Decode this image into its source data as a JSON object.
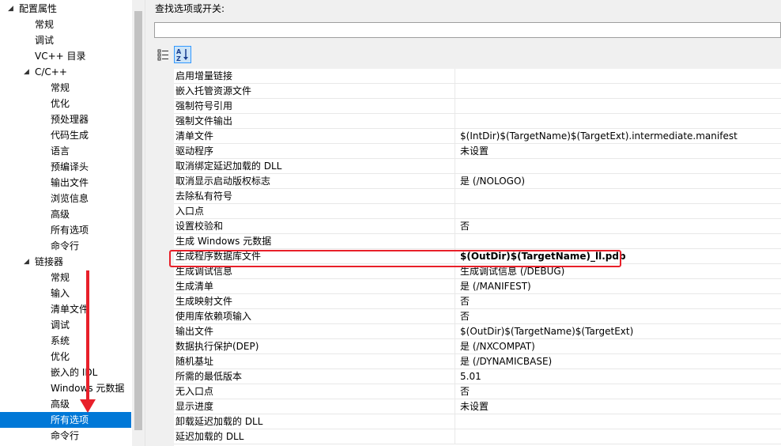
{
  "tree": {
    "items": [
      {
        "label": "配置属性",
        "indent": 1,
        "arrow": "◢",
        "selected": false
      },
      {
        "label": "常规",
        "indent": 2,
        "arrow": "",
        "selected": false
      },
      {
        "label": "调试",
        "indent": 2,
        "arrow": "",
        "selected": false
      },
      {
        "label": "VC++ 目录",
        "indent": 2,
        "arrow": "",
        "selected": false
      },
      {
        "label": "C/C++",
        "indent": 2,
        "arrow": "◢",
        "selected": false
      },
      {
        "label": "常规",
        "indent": 3,
        "arrow": "",
        "selected": false
      },
      {
        "label": "优化",
        "indent": 3,
        "arrow": "",
        "selected": false
      },
      {
        "label": "预处理器",
        "indent": 3,
        "arrow": "",
        "selected": false
      },
      {
        "label": "代码生成",
        "indent": 3,
        "arrow": "",
        "selected": false
      },
      {
        "label": "语言",
        "indent": 3,
        "arrow": "",
        "selected": false
      },
      {
        "label": "预编译头",
        "indent": 3,
        "arrow": "",
        "selected": false
      },
      {
        "label": "输出文件",
        "indent": 3,
        "arrow": "",
        "selected": false
      },
      {
        "label": "浏览信息",
        "indent": 3,
        "arrow": "",
        "selected": false
      },
      {
        "label": "高级",
        "indent": 3,
        "arrow": "",
        "selected": false
      },
      {
        "label": "所有选项",
        "indent": 3,
        "arrow": "",
        "selected": false
      },
      {
        "label": "命令行",
        "indent": 3,
        "arrow": "",
        "selected": false
      },
      {
        "label": "链接器",
        "indent": 2,
        "arrow": "◢",
        "selected": false
      },
      {
        "label": "常规",
        "indent": 3,
        "arrow": "",
        "selected": false
      },
      {
        "label": "输入",
        "indent": 3,
        "arrow": "",
        "selected": false
      },
      {
        "label": "清单文件",
        "indent": 3,
        "arrow": "",
        "selected": false
      },
      {
        "label": "调试",
        "indent": 3,
        "arrow": "",
        "selected": false
      },
      {
        "label": "系统",
        "indent": 3,
        "arrow": "",
        "selected": false
      },
      {
        "label": "优化",
        "indent": 3,
        "arrow": "",
        "selected": false
      },
      {
        "label": "嵌入的 IDL",
        "indent": 3,
        "arrow": "",
        "selected": false
      },
      {
        "label": "Windows 元数据",
        "indent": 3,
        "arrow": "",
        "selected": false
      },
      {
        "label": "高级",
        "indent": 3,
        "arrow": "",
        "selected": false
      },
      {
        "label": "所有选项",
        "indent": 3,
        "arrow": "",
        "selected": true
      },
      {
        "label": "命令行",
        "indent": 3,
        "arrow": "",
        "selected": false
      }
    ]
  },
  "search": {
    "label": "查找选项或开关:",
    "value": ""
  },
  "toolbar": {
    "categorized_icon": "categorized-view-icon",
    "alpha_icon": "sort-alphabetical-icon"
  },
  "grid": {
    "rows": [
      {
        "name": "启用增量链接",
        "value": "",
        "bold": false
      },
      {
        "name": "嵌入托管资源文件",
        "value": "",
        "bold": false
      },
      {
        "name": "强制符号引用",
        "value": "",
        "bold": false
      },
      {
        "name": "强制文件输出",
        "value": "",
        "bold": false
      },
      {
        "name": "清单文件",
        "value": "$(IntDir)$(TargetName)$(TargetExt).intermediate.manifest",
        "bold": false
      },
      {
        "name": "驱动程序",
        "value": "未设置",
        "bold": false
      },
      {
        "name": "取消绑定延迟加载的 DLL",
        "value": "",
        "bold": false
      },
      {
        "name": "取消显示启动版权标志",
        "value": "是 (/NOLOGO)",
        "bold": false
      },
      {
        "name": "去除私有符号",
        "value": "",
        "bold": false
      },
      {
        "name": "入口点",
        "value": "",
        "bold": false
      },
      {
        "name": "设置校验和",
        "value": "否",
        "bold": false
      },
      {
        "name": "生成 Windows 元数据",
        "value": "",
        "bold": false
      },
      {
        "name": "生成程序数据库文件",
        "value": "$(OutDir)$(TargetName)_ll.pdb",
        "bold": true
      },
      {
        "name": "生成调试信息",
        "value": "生成调试信息 (/DEBUG)",
        "bold": false
      },
      {
        "name": "生成清单",
        "value": "是 (/MANIFEST)",
        "bold": false
      },
      {
        "name": "生成映射文件",
        "value": "否",
        "bold": false
      },
      {
        "name": "使用库依赖项输入",
        "value": "否",
        "bold": false
      },
      {
        "name": "输出文件",
        "value": "$(OutDir)$(TargetName)$(TargetExt)",
        "bold": false
      },
      {
        "name": "数据执行保护(DEP)",
        "value": "是 (/NXCOMPAT)",
        "bold": false
      },
      {
        "name": "随机基址",
        "value": "是 (/DYNAMICBASE)",
        "bold": false
      },
      {
        "name": "所需的最低版本",
        "value": "5.01",
        "bold": false
      },
      {
        "name": "无入口点",
        "value": "否",
        "bold": false
      },
      {
        "name": "显示进度",
        "value": "未设置",
        "bold": false
      },
      {
        "name": "卸载延迟加载的 DLL",
        "value": "",
        "bold": false
      },
      {
        "name": "延迟加载的 DLL",
        "value": "",
        "bold": false
      }
    ]
  },
  "colors": {
    "selection": "#0078d7",
    "highlight_box": "#e8202a",
    "annotation_arrow": "#e8202a"
  }
}
